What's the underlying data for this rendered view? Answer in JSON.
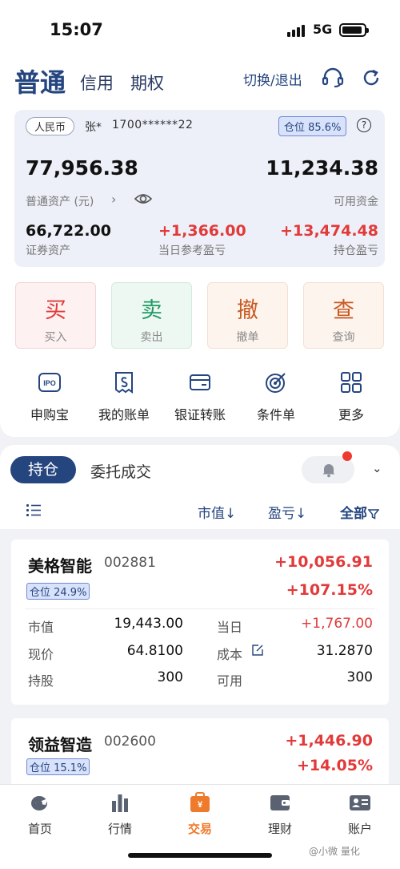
{
  "status_bar": {
    "time": "15:07",
    "network": "5G"
  },
  "account_tabs": [
    "普通",
    "信用",
    "期权"
  ],
  "header": {
    "switch_logout": "切换/退出"
  },
  "asset_card": {
    "currency": "人民币",
    "account_name": "张*",
    "account_no": "1700******22",
    "position_ratio": "仓位 85.6%",
    "total_assets": "77,956.38",
    "total_assets_label": "普通资产 (元)",
    "available_funds": "11,234.38",
    "available_funds_label": "可用资金",
    "securities_assets": "66,722.00",
    "securities_assets_label": "证券资产",
    "today_pnl": "+1,366.00",
    "today_pnl_label": "当日参考盈亏",
    "holding_pnl": "+13,474.48",
    "holding_pnl_label": "持仓盈亏"
  },
  "trade_buttons": [
    {
      "big": "买",
      "small": "买入"
    },
    {
      "big": "卖",
      "small": "卖出"
    },
    {
      "big": "撤",
      "small": "撤单"
    },
    {
      "big": "查",
      "small": "查询"
    }
  ],
  "quick_actions": [
    "申购宝",
    "我的账单",
    "银证转账",
    "条件单",
    "更多"
  ],
  "holdings_tabs": {
    "active": "持仓",
    "other": "委托成交"
  },
  "sort_bar": {
    "market_value": "市值↓",
    "pnl": "盈亏↓",
    "filter": "全部"
  },
  "stocks": [
    {
      "name": "美格智能",
      "code": "002881",
      "pnl": "+10,056.91",
      "position": "仓位 24.9%",
      "pnl_pct": "+107.15%",
      "market_value_label": "市值",
      "market_value": "19,443.00",
      "today_label": "当日",
      "today": "+1,767.00",
      "price_label": "现价",
      "price": "64.8100",
      "cost_label": "成本",
      "cost": "31.2870",
      "shares_label": "持股",
      "shares": "300",
      "available_label": "可用",
      "available": "300"
    },
    {
      "name": "领益智造",
      "code": "002600",
      "pnl": "+1,446.90",
      "position": "仓位 15.1%",
      "pnl_pct": "+14.05%"
    }
  ],
  "bottom_nav": [
    "首页",
    "行情",
    "交易",
    "理财",
    "账户"
  ],
  "colors": {
    "brand": "#25457f",
    "up": "#e23a3a",
    "down": "#1f9a63",
    "accent": "#f07a2b"
  }
}
